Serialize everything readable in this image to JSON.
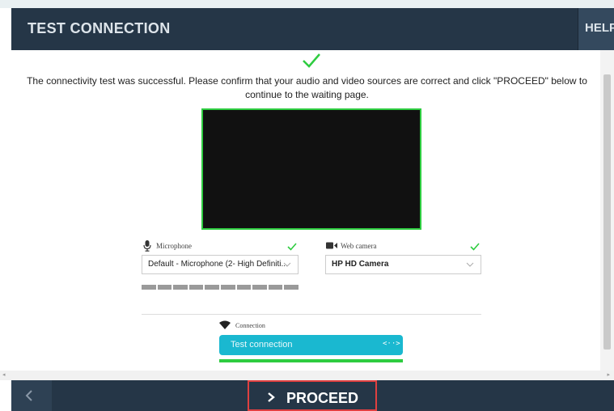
{
  "header": {
    "title": "TEST CONNECTION",
    "help_label": "HELP"
  },
  "message": "The connectivity test was successful. Please confirm that your audio and video sources are correct and click \"PROCEED\" below to continue to the waiting page.",
  "microphone": {
    "label": "Microphone",
    "selected": "Default - Microphone (2- High Definiti...",
    "icon": "microphone-icon",
    "status": "ok"
  },
  "camera": {
    "label": "Web camera",
    "selected": "HP HD Camera",
    "icon": "video-camera-icon",
    "status": "ok"
  },
  "connection": {
    "label": "Connection",
    "button_label": "Test connection",
    "button_icon": "<··>",
    "icon": "wifi-icon",
    "progress": 1.0
  },
  "footer": {
    "proceed_label": "PROCEED",
    "back_icon": "chevron-left-icon"
  },
  "colors": {
    "header_bg": "#253647",
    "accent_green": "#2ecc40",
    "button_cyan": "#1ab8d0",
    "highlight_red": "#e04040"
  }
}
